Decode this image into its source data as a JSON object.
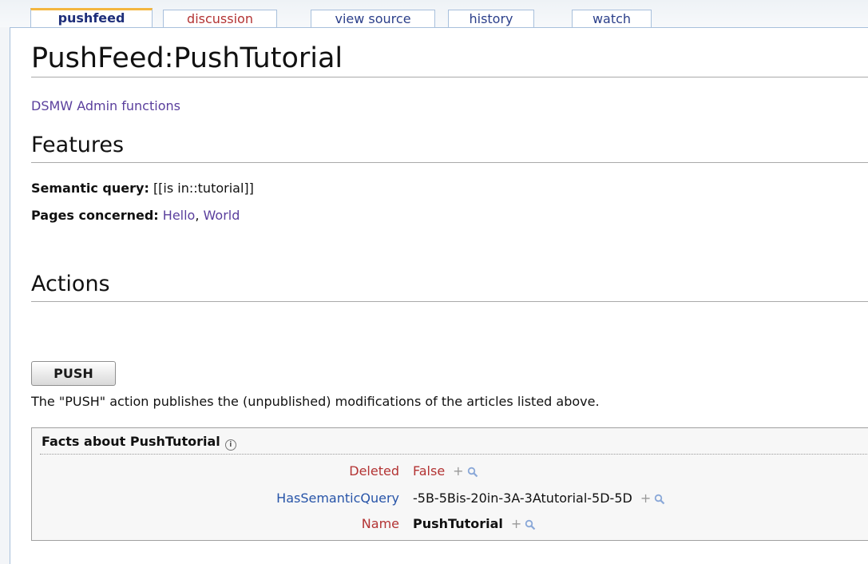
{
  "tabs": [
    {
      "label": "pushfeed"
    },
    {
      "label": "discussion"
    },
    {
      "label": "view source"
    },
    {
      "label": "history"
    },
    {
      "label": "watch"
    }
  ],
  "page": {
    "title": "PushFeed:PushTutorial",
    "admin_link": "DSMW Admin functions"
  },
  "features": {
    "heading": "Features",
    "semantic_query_label": "Semantic query:",
    "semantic_query_value": "[[is in::tutorial]]",
    "pages_label": "Pages concerned:",
    "page_1": "Hello",
    "separator": ",",
    "page_2": "World"
  },
  "actions": {
    "heading": "Actions",
    "push_label": "PUSH",
    "description": "The \"PUSH\" action publishes the (unpublished) modifications of the articles listed above."
  },
  "factbox": {
    "title": "Facts about PushTutorial",
    "info_icon": "ⓘ",
    "rows": [
      {
        "key": "Deleted",
        "value": "False"
      },
      {
        "key": "HasSemanticQuery",
        "value": "-5B-5Bis-20in-3A-3Atutorial-5D-5D"
      },
      {
        "key": "Name",
        "value": "PushTutorial"
      }
    ],
    "plus_symbol": "+"
  },
  "colors": {
    "link": "#5a3f9d",
    "new_link": "#b33333",
    "property_link": "#2754a8",
    "selected_tab_accent": "#f4b63f"
  }
}
